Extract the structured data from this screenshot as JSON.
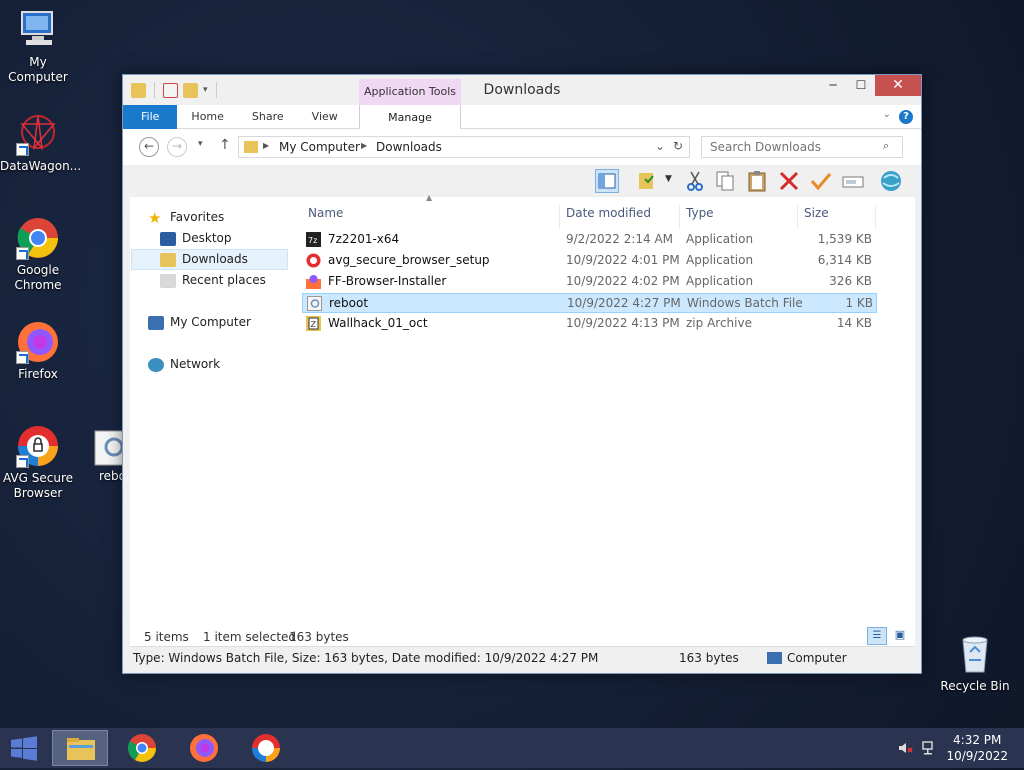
{
  "desktop": {
    "icons": [
      {
        "label": "My Computer"
      },
      {
        "label": "DataWagon..."
      },
      {
        "label": "Google Chrome"
      },
      {
        "label": "Firefox"
      },
      {
        "label": "AVG Secure Browser"
      },
      {
        "label": "rebo"
      },
      {
        "label": "Recycle Bin"
      }
    ]
  },
  "window": {
    "title": "Downloads",
    "context_tab": "Application Tools",
    "controls": {
      "minimize": "─",
      "maximize": "☐",
      "close": "✕"
    },
    "ribbon_tabs": [
      "File",
      "Home",
      "Share",
      "View"
    ],
    "manage_tab": "Manage",
    "help": "?",
    "address": {
      "root": "My Computer",
      "folder": "Downloads"
    },
    "search_placeholder": "Search Downloads",
    "nav_pane": {
      "favorites": "Favorites",
      "desktop": "Desktop",
      "downloads": "Downloads",
      "recent": "Recent places",
      "computer": "My Computer",
      "network": "Network"
    },
    "columns": {
      "name": "Name",
      "date": "Date modified",
      "type": "Type",
      "size": "Size"
    },
    "files": [
      {
        "name": "7z2201-x64",
        "date": "9/2/2022 2:14 AM",
        "type": "Application",
        "size": "1,539 KB"
      },
      {
        "name": "avg_secure_browser_setup",
        "date": "10/9/2022 4:01 PM",
        "type": "Application",
        "size": "6,314 KB"
      },
      {
        "name": "FF-Browser-Installer",
        "date": "10/9/2022 4:02 PM",
        "type": "Application",
        "size": "326 KB"
      },
      {
        "name": "reboot",
        "date": "10/9/2022 4:27 PM",
        "type": "Windows Batch File",
        "size": "1 KB"
      },
      {
        "name": "Wallhack_01_oct",
        "date": "10/9/2022 4:13 PM",
        "type": "zip Archive",
        "size": "14 KB"
      }
    ],
    "status": {
      "items": "5 items",
      "selected": "1 item selected",
      "bytes": "163 bytes",
      "details": "Type: Windows Batch File, Size: 163 bytes, Date modified: 10/9/2022 4:27 PM",
      "size": "163 bytes",
      "location": "Computer"
    }
  },
  "taskbar": {
    "time": "4:32 PM",
    "date": "10/9/2022"
  },
  "colors": {
    "accent": "#1979ca",
    "selection": "#cce8ff",
    "desktop": "#16213a"
  }
}
